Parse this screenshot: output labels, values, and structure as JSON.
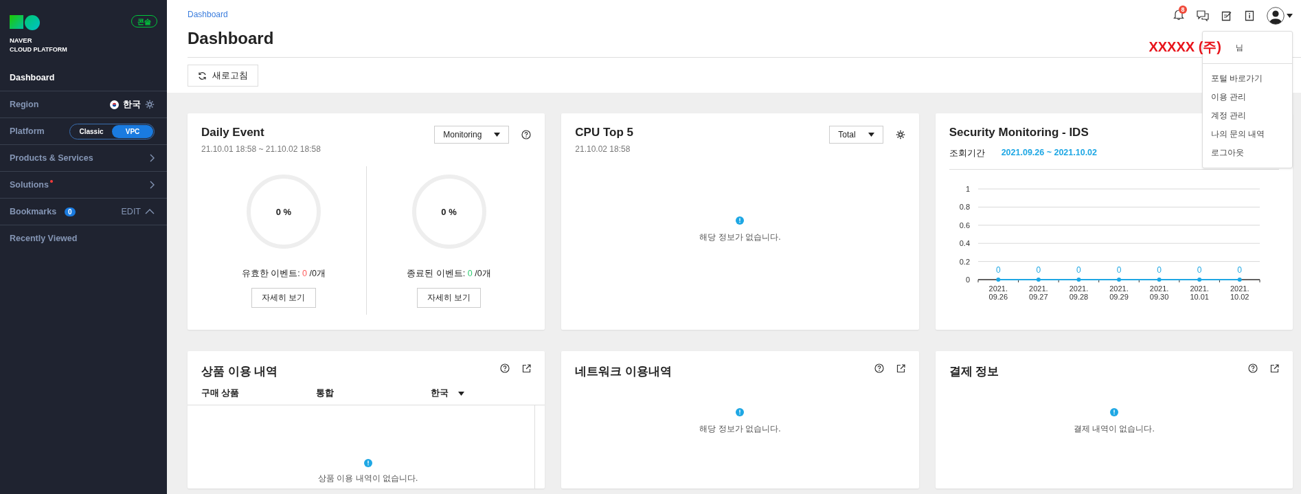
{
  "sidebar": {
    "logo": {
      "line1": "NAVER",
      "line2": "CLOUD PLATFORM"
    },
    "console_badge": "콘솔",
    "items": [
      {
        "kind": "link",
        "label": "Dashboard",
        "selected": true
      },
      {
        "kind": "region",
        "label": "Region",
        "value": "한국"
      },
      {
        "kind": "platform",
        "label": "Platform",
        "options": [
          {
            "label": "Classic",
            "selected": false
          },
          {
            "label": "VPC",
            "selected": true
          }
        ]
      },
      {
        "kind": "menu",
        "label": "Products & Services",
        "new": false
      },
      {
        "kind": "menu",
        "label": "Solutions",
        "new": true
      },
      {
        "kind": "bookmarks",
        "label": "Bookmarks",
        "count": "0",
        "action": "EDIT",
        "expanded": true
      },
      {
        "kind": "link",
        "label": "Recently Viewed",
        "selected": false
      }
    ]
  },
  "header": {
    "breadcrumb": "Dashboard",
    "title": "Dashboard",
    "refresh_button": "새로고침",
    "notification_count": "8"
  },
  "user_menu": {
    "name": "XXXXX (주)",
    "suffix": "님",
    "items": [
      "포털 바로가기",
      "이용 관리",
      "계정 관리",
      "나의 문의 내역",
      "로그아웃"
    ]
  },
  "cards": [
    {
      "kind": "events",
      "title": "Daily Event",
      "subtitle": "21.10.01 18:58 ~ 21.10.02 18:58",
      "dropdown": "Monitoring",
      "help_icon": true,
      "gauges": [
        {
          "value": "0 %",
          "level": 0,
          "label": "유효한 이벤트:",
          "count": "0",
          "total": "/0개",
          "color": "#ff5b5b",
          "button": "자세히 보기"
        },
        {
          "value": "0 %",
          "level": 0,
          "label": "종료된 이벤트:",
          "count": "0",
          "total": "/0개",
          "color": "#2ecc71",
          "button": "자세히 보기"
        }
      ]
    },
    {
      "kind": "empty",
      "title": "CPU Top 5",
      "subtitle": "21.10.02 18:58",
      "dropdown": "Total",
      "settings_icon": true,
      "message": "해당 정보가 없습니다."
    },
    {
      "kind": "chart",
      "title": "Security Monitoring - IDS",
      "period_label": "조회기간",
      "period": "2021.09.26 ~ 2021.10.02",
      "chart_data": {
        "type": "line",
        "categories": [
          "2021.09.26",
          "2021.09.27",
          "2021.09.28",
          "2021.09.29",
          "2021.09.30",
          "2021.10.01",
          "2021.10.02"
        ],
        "values": [
          0,
          0,
          0,
          0,
          0,
          0,
          0
        ],
        "ylim": [
          0,
          1
        ],
        "yticks": [
          0,
          0.2,
          0.4,
          0.6,
          0.8,
          1
        ],
        "data_labels": true,
        "grid": true,
        "marker": true
      }
    },
    {
      "kind": "usage",
      "title": "상품 이용 내역",
      "help_icon": true,
      "external_icon": true,
      "columns": [
        "구매 상품",
        "통합"
      ],
      "region_select": "한국",
      "message": "상품 이용 내역이 없습니다."
    },
    {
      "kind": "empty",
      "title": "네트워크 이용내역",
      "help_icon": true,
      "external_icon": true,
      "message": "해당 정보가 없습니다."
    },
    {
      "kind": "empty",
      "title": "결제 정보",
      "help_icon": true,
      "external_icon": true,
      "message": "결제 내역이 없습니다."
    }
  ]
}
